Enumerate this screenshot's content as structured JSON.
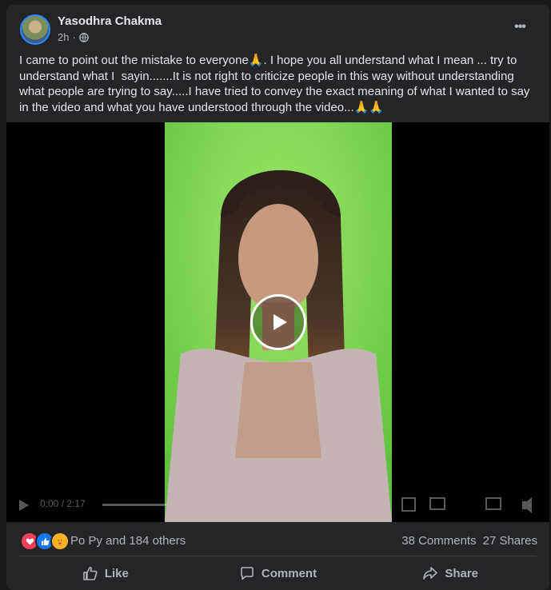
{
  "post": {
    "author": "Yasodhra Chakma",
    "time": "2h",
    "time_separator": "·",
    "privacy_icon": "globe-icon",
    "more_icon": "more-icon",
    "more_label": "•••",
    "text": "I came to point out the mistake to everyone🙏. I hope you all understand what I mean ... try to understand what I  sayin.......It is not right to criticize people in this way without understanding what people are trying to say.....I have tried to convey the exact meaning of what I wanted to say in the video and what you have understood through the video...🙏🙏"
  },
  "video": {
    "play_icon": "play-icon",
    "controls": {
      "time": "0:00 / 2:17"
    }
  },
  "reactions": {
    "icons": [
      "love-icon",
      "like-icon",
      "care-icon"
    ],
    "summary": "Po Py and 184 others",
    "comments": "38 Comments",
    "shares": "27 Shares"
  },
  "actions": {
    "like": "Like",
    "comment": "Comment",
    "share": "Share"
  },
  "colors": {
    "background": "#18191a",
    "card": "#242526",
    "primary_text": "#e4e6eb",
    "secondary_text": "#b0b3b8",
    "love": "#f33e58",
    "like": "#1877f2",
    "care": "#f7b125",
    "video_bg": "#7bd64e"
  }
}
